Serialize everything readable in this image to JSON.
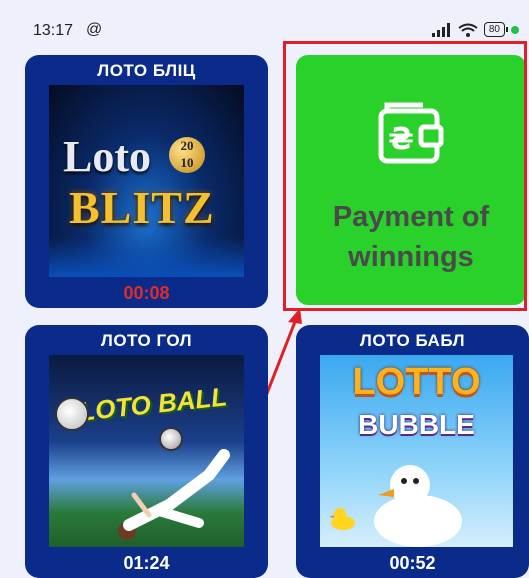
{
  "status": {
    "time": "13:17",
    "at_symbol": "@",
    "battery": "80"
  },
  "games": [
    {
      "title": "ЛОТО БЛІЦ",
      "logo_line1": "Loto",
      "logo_badge_top": "20",
      "logo_badge_bottom": "10",
      "logo_line2": "BLITZ",
      "timer": "00:08"
    },
    {
      "title": "ЛОТО ГОЛ",
      "logo": "LOTO BALL",
      "timer": "01:24"
    },
    {
      "title": "ЛОТО БАБЛ",
      "logo_line1": "LOTTO",
      "logo_line2": "BUBBLE",
      "timer": "00:52"
    }
  ],
  "payment": {
    "label_line1": "Payment of",
    "label_line2": "winnings",
    "icon": "wallet-hryvnia-icon"
  },
  "colors": {
    "card_bg": "#0b2b8a",
    "payment_bg": "#2ad12a",
    "highlight": "#e01f26",
    "timer_alert": "#e02b2b"
  }
}
